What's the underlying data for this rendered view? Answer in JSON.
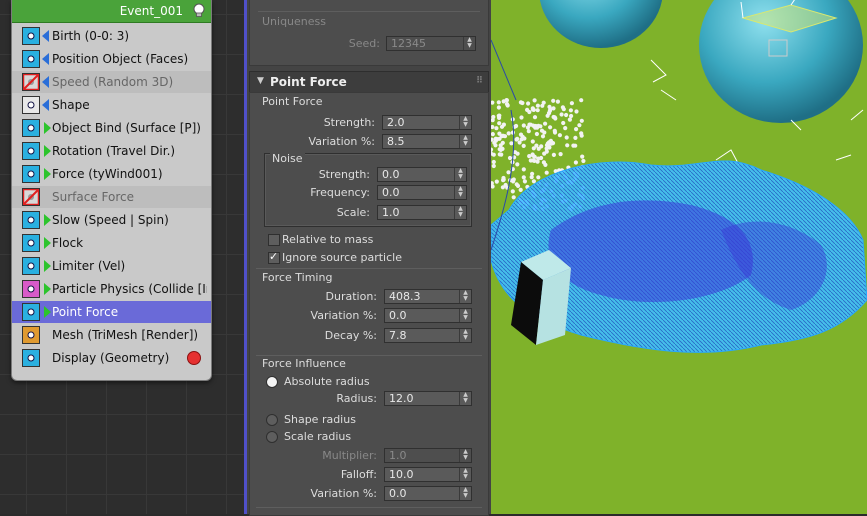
{
  "event": {
    "title": "Event_001",
    "operators": [
      {
        "label": "Birth (0-0: 3)",
        "icon": "birth-icon",
        "state": "normal",
        "port": "blue",
        "color": "#2ab0e0"
      },
      {
        "label": "Position Object (Faces)",
        "icon": "position-object-icon",
        "state": "normal",
        "port": "blue",
        "color": "#2ab0e0"
      },
      {
        "label": "Speed (Random 3D)",
        "icon": "speed-icon",
        "state": "disabled",
        "port": "blue",
        "color": "#d8d8d8"
      },
      {
        "label": "Shape",
        "icon": "shape-icon",
        "state": "normal",
        "port": "blue",
        "color": "#e8e8e8"
      },
      {
        "label": "Object Bind (Surface [P])",
        "icon": "object-bind-icon",
        "state": "normal",
        "port": "green",
        "color": "#2ab0e0"
      },
      {
        "label": "Rotation (Travel Dir.)",
        "icon": "rotation-icon",
        "state": "normal",
        "port": "green",
        "color": "#2ab0e0"
      },
      {
        "label": "Force (tyWind001)",
        "icon": "force-icon",
        "state": "normal",
        "port": "green",
        "color": "#2ab0e0"
      },
      {
        "label": "Surface Force",
        "icon": "surface-force-icon",
        "state": "disabled",
        "port": "none",
        "color": "#d8d8d8"
      },
      {
        "label": "Slow (Speed | Spin)",
        "icon": "slow-icon",
        "state": "normal",
        "port": "green",
        "color": "#2ab0e0"
      },
      {
        "label": "Flock",
        "icon": "flock-icon",
        "state": "normal",
        "port": "green",
        "color": "#2ab0e0"
      },
      {
        "label": "Limiter (Vel)",
        "icon": "limiter-icon",
        "state": "normal",
        "port": "green",
        "color": "#2ab0e0"
      },
      {
        "label": "Particle Physics (Collide [In...",
        "icon": "particle-physics-icon",
        "state": "normal",
        "port": "green",
        "color": "#d85ac8"
      },
      {
        "label": "Point Force",
        "icon": "point-force-icon",
        "state": "selected",
        "port": "green",
        "color": "#2ab0e0"
      },
      {
        "label": "Mesh (TriMesh [Render])",
        "icon": "mesh-icon",
        "state": "normal",
        "port": "none",
        "color": "#e09a30"
      },
      {
        "label": "Display (Geometry)",
        "icon": "display-icon",
        "state": "normal",
        "port": "none",
        "color": "#2ab0e0"
      }
    ]
  },
  "uniqueness": {
    "title": "Uniqueness",
    "seed_label": "Seed:",
    "seed_value": "12345"
  },
  "point_force": {
    "rollout_title": "Point Force",
    "group_title": "Point Force",
    "strength_label": "Strength:",
    "strength_value": "2.0",
    "variation_label": "Variation %:",
    "variation_value": "8.5",
    "noise": {
      "title": "Noise",
      "strength_label": "Strength:",
      "strength_value": "0.0",
      "frequency_label": "Frequency:",
      "frequency_value": "0.0",
      "scale_label": "Scale:",
      "scale_value": "1.0"
    },
    "relative_to_mass_label": "Relative to mass",
    "relative_to_mass_checked": false,
    "ignore_source_label": "Ignore source particle",
    "ignore_source_checked": true,
    "timing": {
      "title": "Force Timing",
      "duration_label": "Duration:",
      "duration_value": "408.3",
      "variation_label": "Variation %:",
      "variation_value": "0.0",
      "decay_label": "Decay %:",
      "decay_value": "7.8"
    },
    "influence": {
      "title": "Force Influence",
      "absolute_radius_label": "Absolute radius",
      "radius_label": "Radius:",
      "radius_value": "12.0",
      "shape_radius_label": "Shape radius",
      "scale_radius_label": "Scale radius",
      "multiplier_label": "Multiplier:",
      "multiplier_value": "1.0",
      "falloff_label": "Falloff:",
      "falloff_value": "10.0",
      "variation_label": "Variation %:",
      "variation_value": "0.0",
      "selected_mode": "absolute"
    }
  },
  "colors": {
    "viewport_bg": "#7fb22a",
    "selection": "#6a6ad8",
    "event_header": "#4aa33a",
    "particle_cyan": "#3fc0ff"
  }
}
